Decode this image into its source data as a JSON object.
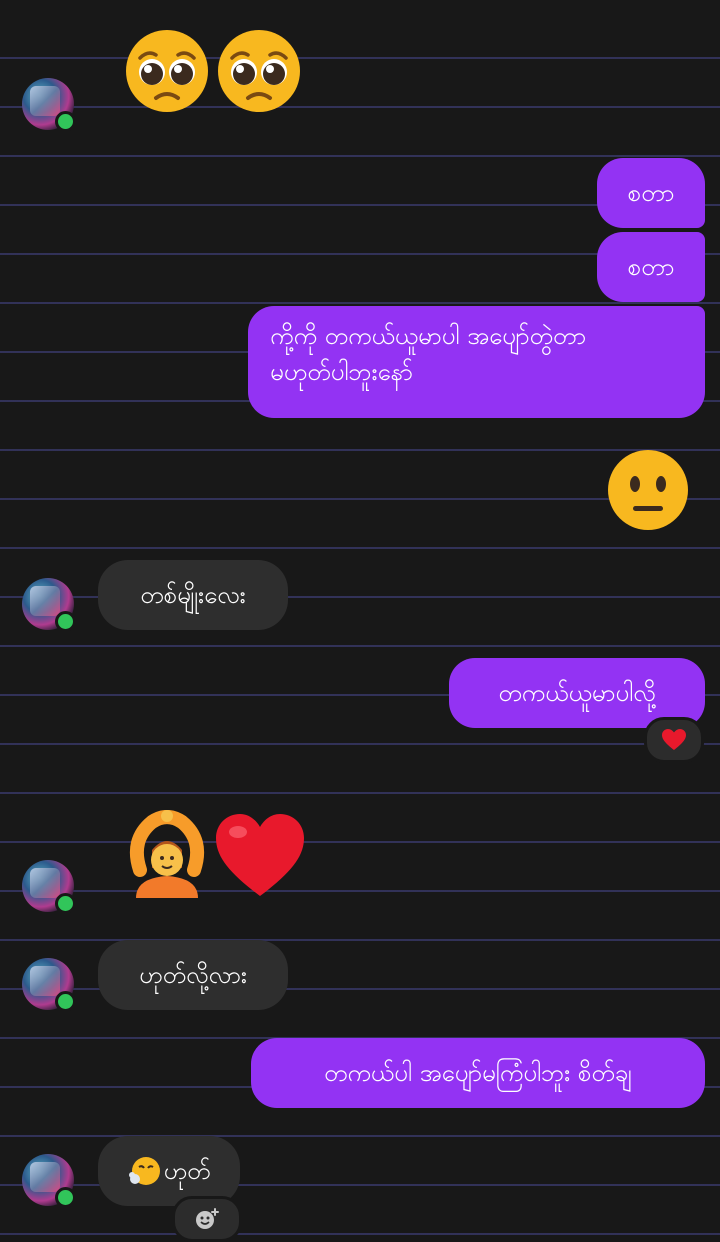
{
  "messages": {
    "m1": "စတာ",
    "m2": "စတာ",
    "m3_line1": "ကို့ကို တကယ်ယူမာပါ အပျော်တွဲတာ",
    "m3_line2": "မဟုတ်ပါဘူးနော်",
    "m4": "တစ်မျိုးလေး",
    "m5": "တကယ်ယူမာပါလို့",
    "m6": "ဟုတ်လို့လား",
    "m7": "တကယ်ပါ အပျော်မကြံပါဘူး စိတ်ချ",
    "m8": "ဟုတ်"
  },
  "icons": {
    "pleading_face": "pleading-face-emoji",
    "neutral_face": "neutral-face-emoji",
    "person_gesturing_ok": "person-gesturing-ok-emoji",
    "red_heart": "red-heart-emoji",
    "face_exhaling": "face-exhaling-emoji",
    "add_reaction": "add-reaction-icon"
  },
  "colors": {
    "outgoing_bubble": "#9333f3",
    "incoming_bubble": "#2e2e2e",
    "online_dot": "#31c55a",
    "background": "#181818"
  }
}
